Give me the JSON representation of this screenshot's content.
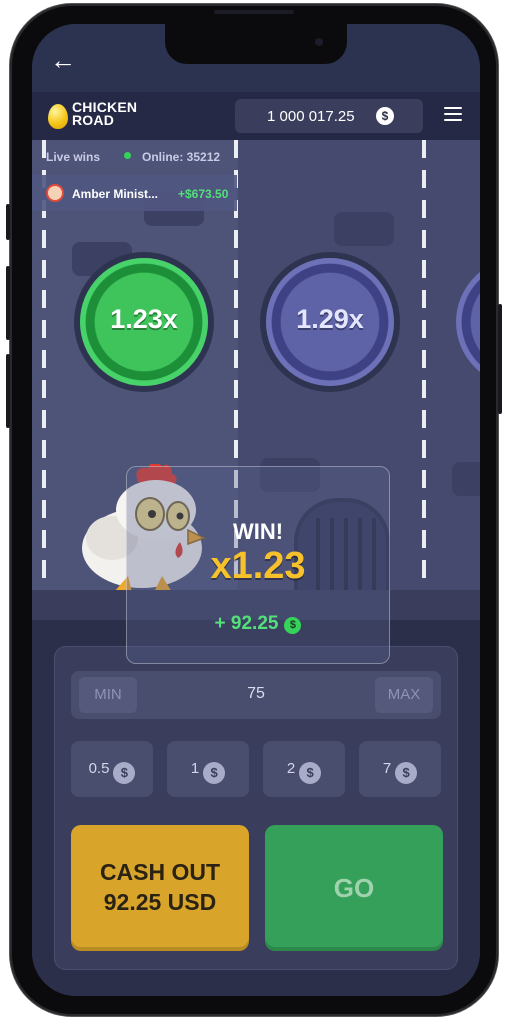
{
  "header": {
    "logo_line1": "CHICKEN",
    "logo_line2": "ROAD",
    "balance": "1 000 017.25",
    "currency_symbol": "$"
  },
  "live": {
    "label": "Live wins",
    "online": "Online: 35212",
    "latest_winner": {
      "name": "Amber Minist...",
      "amount": "+$673.50"
    }
  },
  "lanes": {
    "multipliers": [
      "1.23x",
      "1.29x"
    ]
  },
  "win_popup": {
    "title": "WIN!",
    "multiplier": "x1.23",
    "amount": "+ 92.25",
    "currency_symbol": "$"
  },
  "bet_controls": {
    "min_label": "MIN",
    "bet_value": "75",
    "max_label": "MAX",
    "chips": [
      "0.5",
      "1",
      "2",
      "7"
    ],
    "currency_symbol": "$"
  },
  "actions": {
    "cashout_line1": "CASH OUT",
    "cashout_line2": "92.25 USD",
    "go_label": "GO"
  },
  "colors": {
    "green_accent": "#35a05a",
    "cashout_gold": "#d8a52a",
    "multiplier_gold": "#f6c12a",
    "win_green": "#53e07a"
  }
}
